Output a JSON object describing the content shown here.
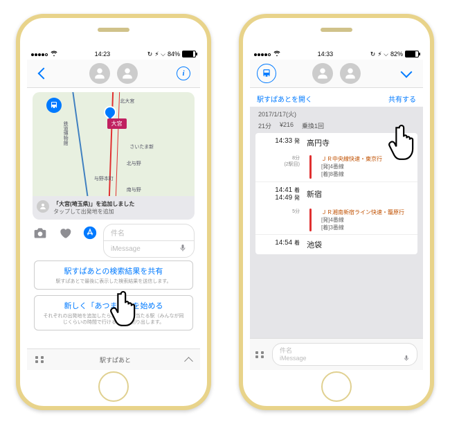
{
  "status": {
    "carrier_dots": 5,
    "time_left": "14:23",
    "time_right": "14:33",
    "battery_left": "84%",
    "battery_right": "82%",
    "bt": "⚡︎"
  },
  "left": {
    "map_station": "大宮",
    "map_labels": {
      "a": "北大宮",
      "b": "鉄道博物館",
      "c": "さいたま新",
      "d": "北与野",
      "e": "与野本町",
      "f": "南与野"
    },
    "caption_title": "「大宮(埼玉県)」を追加しました",
    "caption_sub": "タップして出発地を追加",
    "subject_placeholder": "件名",
    "message_placeholder": "iMessage",
    "option1_title": "駅すぱあとの検索結果を共有",
    "option1_sub": "駅すぱあとで最後に表示した検索結果を送信します。",
    "option2_title": "新しく「あつまる」を始める",
    "option2_sub": "それぞれの出発地を追加したら、みんなに当たる駅（みんなが同じくらいの時間で行ける駅）を割り出します。",
    "drawer_label": "駅すぱあと"
  },
  "right": {
    "open_link": "駅すぱあとを開く",
    "share_link": "共有する",
    "date": "2017/1/17(火)",
    "meta_duration": "21分",
    "meta_fare": "¥216",
    "meta_transfers": "乗換1回",
    "stops": [
      {
        "time": "14:33",
        "suffix": "発",
        "name": "高円寺"
      },
      {
        "time_a": "14:41",
        "suffix_a": "着",
        "time_b": "14:49",
        "suffix_b": "発",
        "name": "新宿"
      },
      {
        "time": "14:54",
        "suffix": "着",
        "name": "池袋"
      }
    ],
    "segments": [
      {
        "dur": "8分",
        "dur_sub": "(2駅目)",
        "line": "ＪＲ中央線快速・東京行",
        "dep": "[発]4番線",
        "arr": "[着]8番線"
      },
      {
        "dur": "5分",
        "dur_sub": "",
        "line": "ＪＲ湘南新宿ライン快速・籠原行",
        "dep": "[発]4番線",
        "arr": "[着]3番線"
      }
    ],
    "subject_placeholder": "件名",
    "message_placeholder": "iMessage"
  }
}
